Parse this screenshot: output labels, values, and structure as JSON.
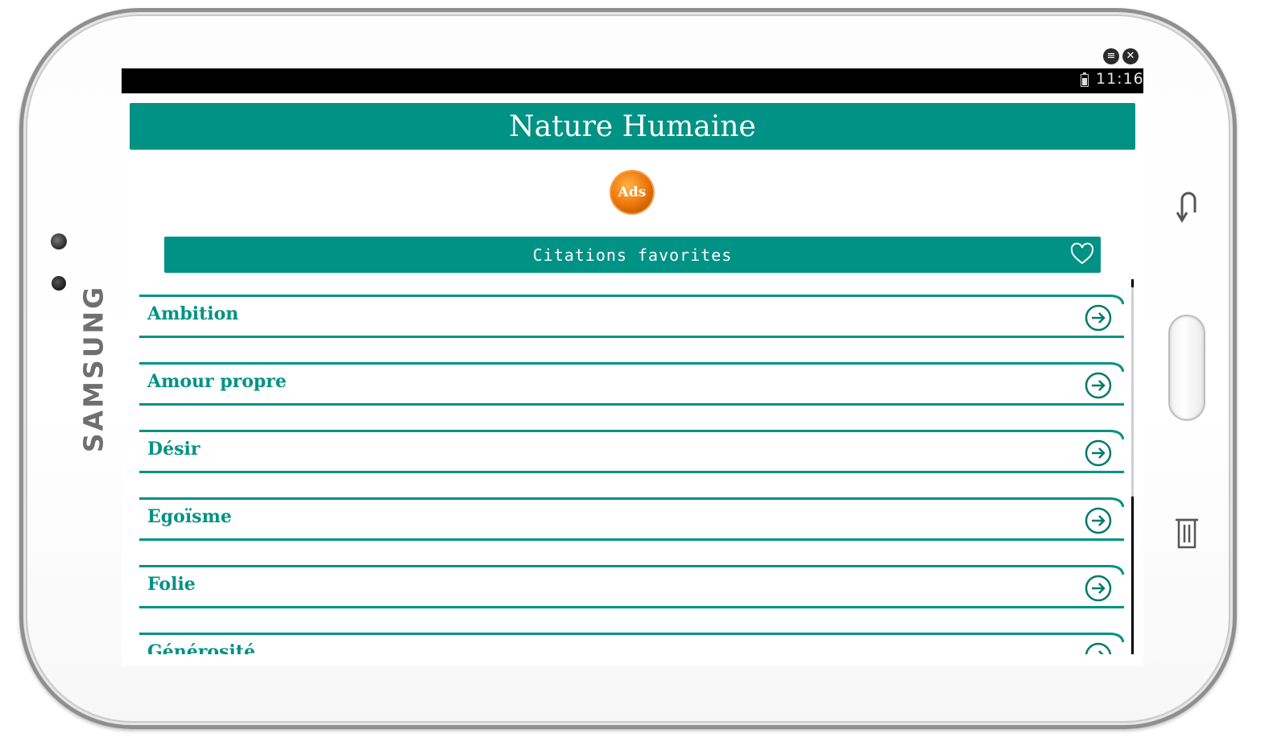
{
  "device": {
    "brand": "SAMSUNG"
  },
  "statusbar": {
    "time": "11:16"
  },
  "header": {
    "title": "Nature Humaine"
  },
  "ads": {
    "label": "Ads"
  },
  "favorites": {
    "label": "Citations favorites",
    "icon": "heart-icon"
  },
  "categories": {
    "items": [
      {
        "label": "Ambition"
      },
      {
        "label": "Amour propre"
      },
      {
        "label": "Désir"
      },
      {
        "label": "Egoïsme"
      },
      {
        "label": "Folie"
      },
      {
        "label": "Générosité"
      }
    ],
    "item_icon": "arrow-circle-right-icon"
  },
  "colors": {
    "accent": "#009284",
    "statusbar": "#000000",
    "ads_badge": "#f07b10"
  }
}
